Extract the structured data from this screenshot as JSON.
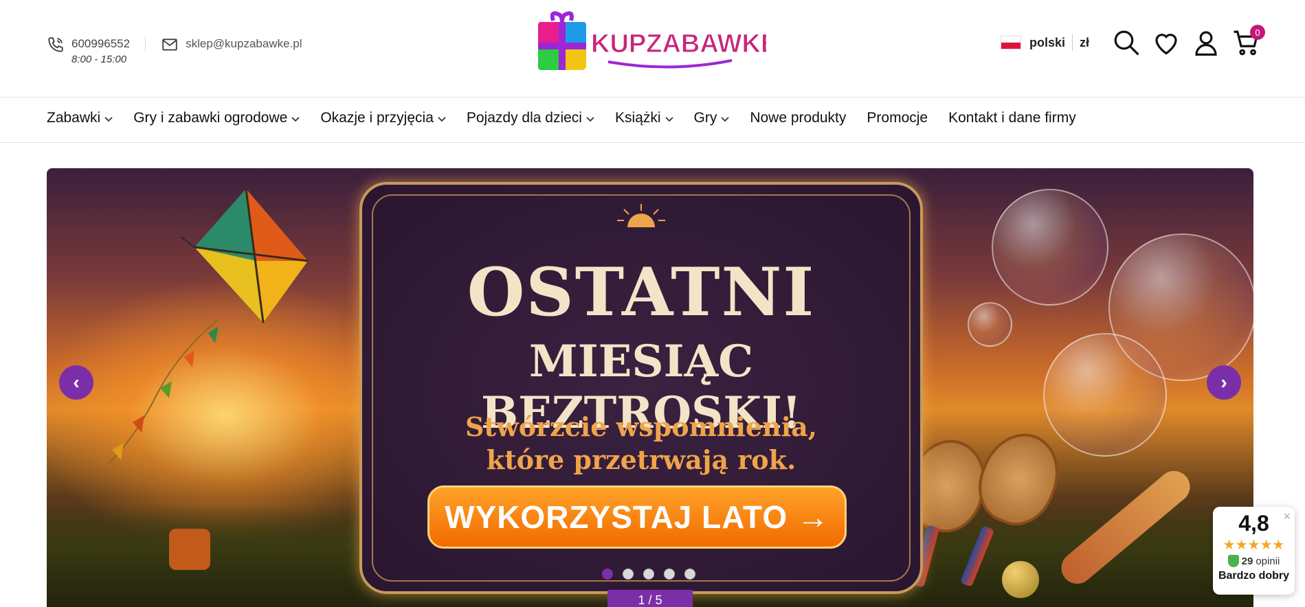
{
  "header": {
    "phone": "600996552",
    "hours": "8:00 - 15:00",
    "email": "sklep@kupzabawke.pl",
    "logo_text": "KUPZABAWKE.PL",
    "language": "polski",
    "currency": "zł",
    "cart_count": "0"
  },
  "nav": {
    "items": [
      {
        "label": "Zabawki",
        "has_dropdown": true
      },
      {
        "label": "Gry i zabawki ogrodowe",
        "has_dropdown": true
      },
      {
        "label": "Okazje i przyjęcia",
        "has_dropdown": true
      },
      {
        "label": "Pojazdy dla dzieci",
        "has_dropdown": true
      },
      {
        "label": "Książki",
        "has_dropdown": true
      },
      {
        "label": "Gry",
        "has_dropdown": true
      },
      {
        "label": "Nowe produkty",
        "has_dropdown": false
      },
      {
        "label": "Promocje",
        "has_dropdown": false
      },
      {
        "label": "Kontakt i dane firmy",
        "has_dropdown": false
      }
    ]
  },
  "banner": {
    "title_line1": "OSTATNI",
    "title_line2": "MIESIĄC BEZTROSKI!",
    "subtitle_line1": "Stwórzcie wspomnienia,",
    "subtitle_line2": "które przetrwają rok.",
    "cta_label": "WYKORZYSTAJ LATO →",
    "slide_counter": "1 / 5",
    "active_slide": 1,
    "total_slides": 5,
    "prev_icon": "‹",
    "next_icon": "›"
  },
  "rating": {
    "score": "4,8",
    "stars": "★★★★★",
    "count": "29",
    "count_label": "opinii",
    "verdict": "Bardzo dobry",
    "close_icon": "×"
  },
  "colors": {
    "accent": "#7a2fa8",
    "badge": "#c2187a",
    "cta": "#f26a00",
    "star": "#f5a623"
  }
}
